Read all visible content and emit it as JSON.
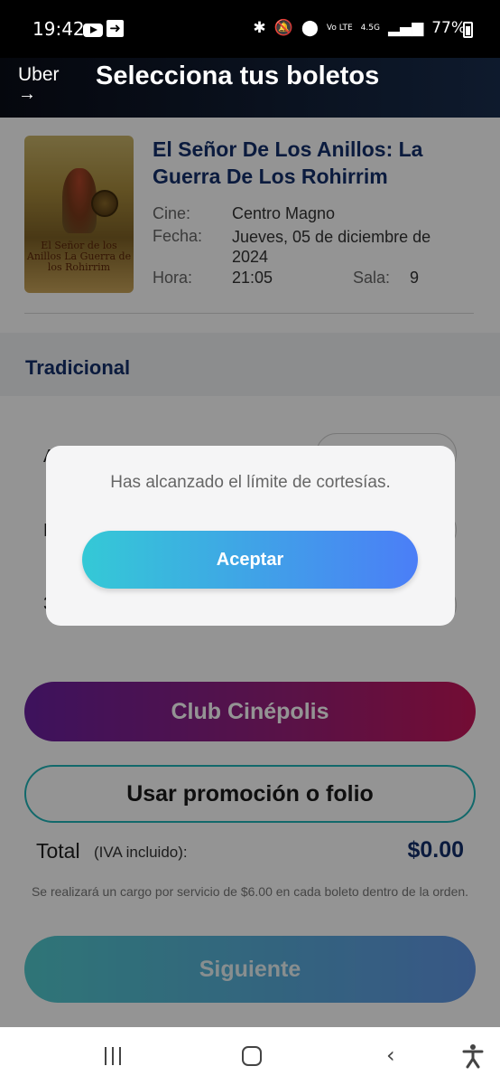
{
  "status_bar": {
    "time": "19:42",
    "battery": "77%",
    "network": "4.5G",
    "carrier": "Vo LTE"
  },
  "header": {
    "logo": "Uber",
    "logo_arrow": "→",
    "title": "Selecciona tus boletos"
  },
  "movie": {
    "title": "El Señor De Los Anillos: La Guerra De Los Rohirrim",
    "poster_text": "El Señor de los Anillos La Guerra de los Rohirrim",
    "cine_label": "Cine:",
    "cine": "Centro Magno",
    "fecha_label": "Fecha:",
    "fecha": "Jueves, 05 de diciembre de 2024",
    "hora_label": "Hora:",
    "hora": "21:05",
    "sala_label": "Sala:",
    "sala": "9"
  },
  "section": {
    "title": "Tradicional"
  },
  "tickets": [
    {
      "letter": "A"
    },
    {
      "letter": "N"
    },
    {
      "letter": "3"
    }
  ],
  "buttons": {
    "club": "Club Cinépolis",
    "promo": "Usar promoción o folio",
    "next": "Siguiente"
  },
  "total": {
    "label": "Total",
    "sub": "(IVA incluido):",
    "amount": "$0.00",
    "note": "Se realizará un cargo por servicio de $6.00 en cada boleto dentro de la orden."
  },
  "modal": {
    "message": "Has alcanzado el límite de cortesías.",
    "button": "Aceptar"
  },
  "colors": {
    "brand_blue": "#14306b",
    "club_start": "#6a1fa0",
    "club_end": "#c6165a",
    "accept_start": "#34c9d6",
    "accept_end": "#4b7ef7"
  }
}
